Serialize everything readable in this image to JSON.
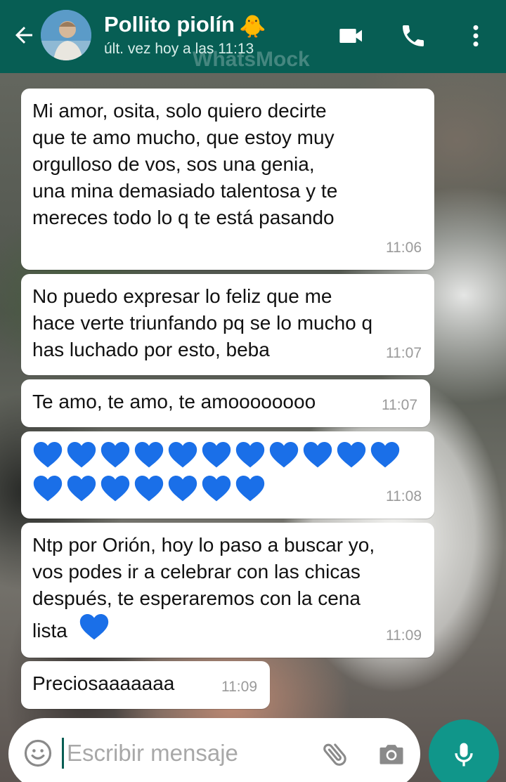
{
  "header": {
    "contact_name": "Pollito piolín",
    "contact_emoji": "🐥",
    "last_seen": "últ. vez hoy a las 11:13",
    "watermark": "WhatsMock",
    "icons": [
      "back-arrow-icon",
      "avatar",
      "video-call-icon",
      "voice-call-icon",
      "more-options-icon"
    ]
  },
  "colors": {
    "header_bg": "#075e54",
    "bubble_bg": "#ffffff",
    "time_text": "#9a9a9a",
    "mic_button_bg": "#10968a",
    "heart": "#1a6fe8"
  },
  "messages": [
    {
      "text": "Mi amor, osita, solo quiero decirte\nque te amo mucho, que estoy muy\norgulloso de vos, sos una genia,\nuna mina demasiado talentosa y te\nmereces todo lo q te está pasando",
      "time": "11:06"
    },
    {
      "text": "No puedo expresar lo feliz que me\nhace verte triunfando pq se lo mucho q\nhas luchado por esto, beba",
      "time": "11:07"
    },
    {
      "text": "Te amo, te amo, te amoooooooo",
      "time": "11:07"
    },
    {
      "hearts_row1": 11,
      "hearts_row2": 7,
      "time": "11:08"
    },
    {
      "text": "Ntp por Orión, hoy lo paso a buscar yo,\nvos podes ir a celebrar con las chicas\ndespués, te esperaremos con la cena\nlista",
      "time": "11:09"
    },
    {
      "text": "Preciosaaaaaaa",
      "time": "11:09"
    }
  ],
  "input": {
    "placeholder": "Escribir mensaje",
    "icons": [
      "emoji-icon",
      "attach-clip-icon",
      "camera-icon",
      "microphone-icon"
    ]
  }
}
